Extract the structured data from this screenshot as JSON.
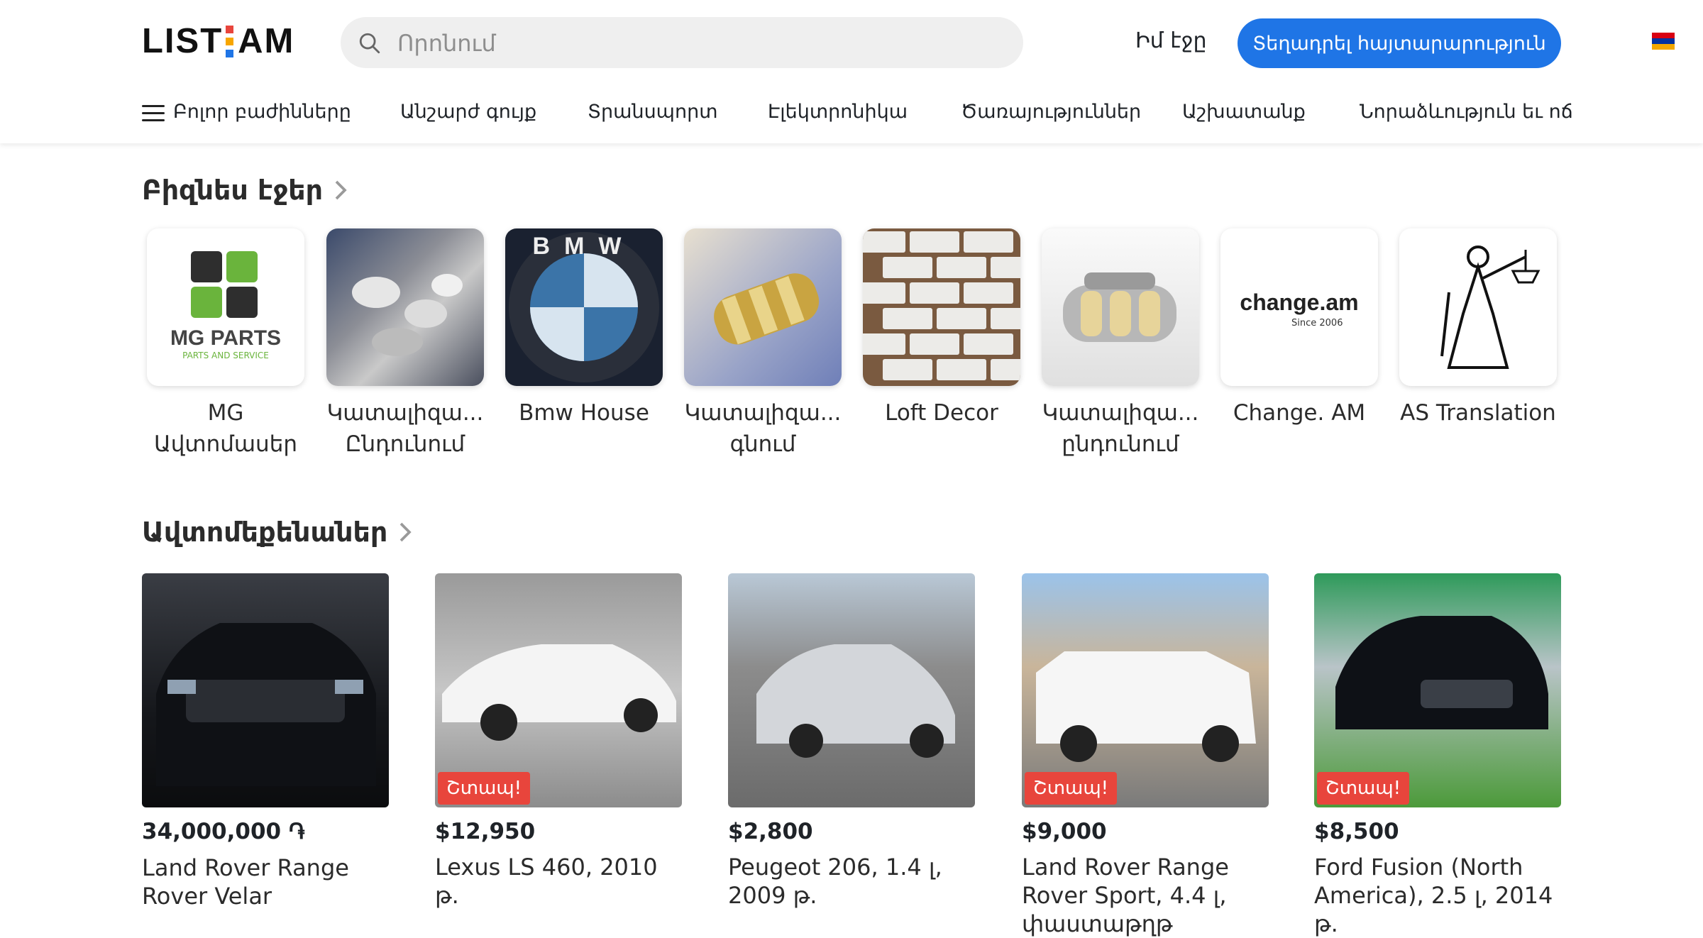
{
  "header": {
    "logo": {
      "left": "LIST",
      "right": "AM"
    },
    "search": {
      "placeholder": "Որոնում"
    },
    "my_page": "Իմ էջը",
    "post_button": "Տեղադրել հայտարարություն",
    "flag_colors": [
      "#d90012",
      "#0033a0",
      "#f2a800"
    ]
  },
  "nav": {
    "all_categories": "Բոլոր բաժինները",
    "items": [
      "Անշարժ գույք",
      "Տրանսպորտ",
      "Էլեկտրոնիկա",
      "Ծառայություններ",
      "Աշխատանք",
      "Նորաձևություն եւ ոճ"
    ]
  },
  "business_pages": {
    "title": "Բիզնես էջեր",
    "items": [
      {
        "name": "MG Ավտոմասեր",
        "logo_text": "MG PARTS",
        "logo_sub": "PARTS AND SERVICE"
      },
      {
        "name": "Կատալիզա... Ընդունում"
      },
      {
        "name": "Bmw House",
        "logo_text": "BMW"
      },
      {
        "name": "Կատալիզա... գնում"
      },
      {
        "name": "Loft Decor"
      },
      {
        "name": "Կատալիզա... ընդունում"
      },
      {
        "name": "Change. AM",
        "logo_text": "change.am",
        "logo_sub": "Since 2006"
      },
      {
        "name": "AS Translation"
      }
    ]
  },
  "cars": {
    "title": "Ավտոմեքենաներ",
    "items": [
      {
        "price": "34,000,000 ֏",
        "title": "Land Rover Range Rover Velar",
        "badge": ""
      },
      {
        "price": "$12,950",
        "title": "Lexus LS 460, 2010 թ.",
        "badge": "Շտապ!"
      },
      {
        "price": "$2,800",
        "title": "Peugeot 206, 1.4 լ, 2009 թ.",
        "badge": ""
      },
      {
        "price": "$9,000",
        "title": "Land Rover Range Rover Sport, 4.4 լ, փաստաթղթ",
        "badge": "Շտապ!"
      },
      {
        "price": "$8,500",
        "title": "Ford Fusion (North America), 2.5 լ, 2014 թ.",
        "badge": "Շտապ!"
      }
    ]
  },
  "colors": {
    "accent": "#1f75e6",
    "urgent": "#e8453c"
  }
}
